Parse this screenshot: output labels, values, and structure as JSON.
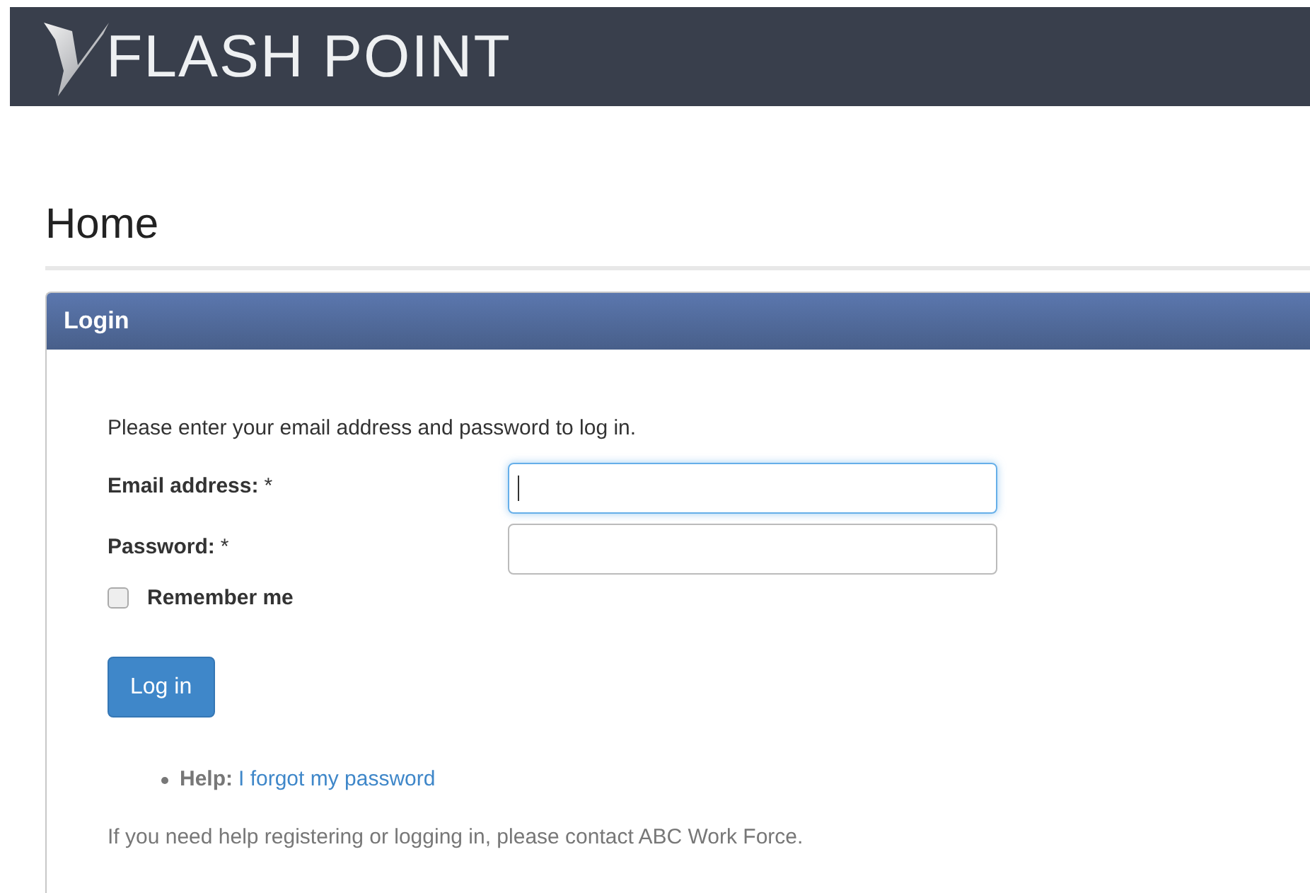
{
  "header": {
    "brand": "FLASH POINT"
  },
  "page_title": "Home",
  "login_panel": {
    "title": "Login",
    "intro": "Please enter your email address and password to log in.",
    "fields": [
      {
        "label": "Email address:",
        "required_mark": "*",
        "focused": true
      },
      {
        "label": "Password:",
        "required_mark": "*",
        "focused": false
      }
    ],
    "remember": {
      "label": "Remember me",
      "checked": false
    },
    "submit": "Log in",
    "help": {
      "label": "Help:",
      "link": "I forgot my password"
    },
    "footer_note": "If you need help registering or logging in, please contact ABC Work Force."
  }
}
